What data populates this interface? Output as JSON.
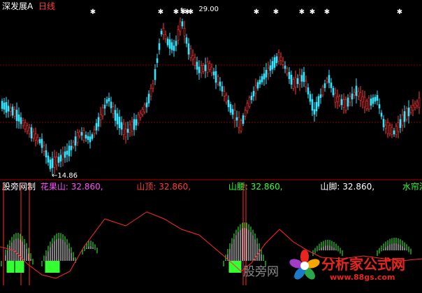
{
  "header": {
    "stock_name": "深发展A",
    "period": "日线",
    "colors": {
      "stock_name": "#ffffff",
      "period": "#ff3b3b"
    }
  },
  "price_labels": {
    "high": "29.00",
    "low": "14.86",
    "high_prefix": "←",
    "low_prefix": "←"
  },
  "indicator": {
    "name": "股旁网制",
    "items": [
      {
        "label": "花果山:",
        "value": "32.860,",
        "color": "#ff4fff"
      },
      {
        "label": "山顶:",
        "value": "32.860,",
        "color": "#ff3b3b"
      },
      {
        "label": "山腰:",
        "value": "32.860,",
        "color": "#33ff33"
      },
      {
        "label": "山脚:",
        "value": "32.860,",
        "color": "#ffffff"
      },
      {
        "label": "水帘洞",
        "value": "",
        "color": "#33ff33"
      }
    ]
  },
  "overlay_watermark": "股旁网",
  "site_watermark": {
    "text": "分析家公式网",
    "url": "www.88gs.com"
  },
  "colors": {
    "up": "#ff3b3b",
    "down": "#33e6ff",
    "grid": "#8b0000",
    "white": "#ffffff",
    "green": "#33ff33",
    "red_line": "#ff2a2a"
  }
}
